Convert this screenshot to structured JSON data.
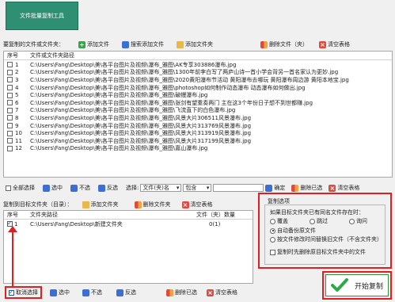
{
  "title_button": "文件批量复制工具",
  "top_toolbar": {
    "label": "要复制的文件或文件夹：",
    "add_file": "添加文件",
    "search_add_file": "搜索添加文件",
    "add_folder": "添加文件夹",
    "delete_file": "删除文件（夹）",
    "clear_table": "清空表格"
  },
  "file_table": {
    "columns": [
      "序号",
      "文件或文件夹路径"
    ],
    "rows": [
      {
        "num": "1",
        "path": "C:\\Users\\Fang\\Desktop\\美\\各平台图片及视频\\瀑布_雅图\\AK专享303886瀑布.jpg"
      },
      {
        "num": "2",
        "path": "C:\\Users\\Fang\\Desktop\\美\\各平台图片及视频\\瀑布_雅图\\1300年前李白写了两庐山诗一首小学会背另一首名家认为更妙.jpg"
      },
      {
        "num": "3",
        "path": "C:\\Users\\Fang\\Desktop\\美\\各平台图片及视频\\瀑布_雅图\\2020黄阳瀑布节活动 黄阳瀑布去哪玩 黄阳瀑布周边游 黄阳本地宝.jpg"
      },
      {
        "num": "4",
        "path": "C:\\Users\\Fang\\Desktop\\美\\各平台图片及视频\\瀑布_雅图\\photoshop如何制作动态瀑布 动态瀑布如何做出.jpg"
      },
      {
        "num": "5",
        "path": "C:\\Users\\Fang\\Desktop\\美\\各平台图片及视频\\瀑布_雅图\\破幔瀑布.jpg"
      },
      {
        "num": "6",
        "path": "C:\\Users\\Fang\\Desktop\\美\\各平台图片及视频\\瀑布_雅图\\张剑有望重奏两门 主在这3个年份日子想不到世都赚.jpg"
      },
      {
        "num": "7",
        "path": "C:\\Users\\Fang\\Desktop\\美\\各平台图片及视频\\瀑布_雅图\\飞流直下的白色瀑布.jpg"
      },
      {
        "num": "8",
        "path": "C:\\Users\\Fang\\Desktop\\美\\各平台图片及视频\\瀑布_雅图\\风景大片306511风景瀑布.jpg"
      },
      {
        "num": "9",
        "path": "C:\\Users\\Fang\\Desktop\\美\\各平台图片及视频\\瀑布_雅图\\风景大片313769风景瀑布.jpg"
      },
      {
        "num": "10",
        "path": "C:\\Users\\Fang\\Desktop\\美\\各平台图片及视频\\瀑布_雅图\\风景大片313919风景瀑布.jpg"
      },
      {
        "num": "11",
        "path": "C:\\Users\\Fang\\Desktop\\美\\各平台图片及视频\\瀑布_雅图\\风景大片317199风景瀑布.jpg"
      },
      {
        "num": "12",
        "path": "C:\\Users\\Fang\\Desktop\\美\\各平台图片及视频\\瀑布_雅图\\嘉山瀑布.jpg"
      }
    ]
  },
  "mid_toolbar": {
    "select_all": "全部选择",
    "select": "选中",
    "unselect": "不选",
    "invert": "反选",
    "choose_label": "选择:",
    "choose_value": "文件(夹)名",
    "contains_value": "包含",
    "confirm": "确定",
    "delete_selected": "删除已选",
    "clear_table": "清空表格"
  },
  "target_toolbar": {
    "label": "复制到目标文件夹（目录）：",
    "add_folder": "添加文件夹",
    "delete_folder": "删除文件夹",
    "clear_table": "清空表格"
  },
  "target_table": {
    "columns": [
      "序号",
      "文件夹路径",
      "文件（夹）数量"
    ],
    "rows": [
      {
        "num": "1",
        "path": "C:\\Users\\Fang\\Desktop\\新建文件夹",
        "count": "0(1)"
      }
    ]
  },
  "bottom_toolbar": {
    "cancel_select": "取消选择",
    "select": "选中",
    "unselect": "不选",
    "invert": "反选",
    "delete_selected": "删除已选",
    "clear_table": "清空表格"
  },
  "copy_options": {
    "title": "复制选项",
    "conflict_label": "如果目标文件夹已有同名文件存在时：",
    "overwrite": "覆盖",
    "skip": "跳过",
    "ask": "询问",
    "auto_rename": "自动备份原文件",
    "rename_by_time": "按文件修改时间替换旧文件（不含文件夹）",
    "clear_target": "复制时先删除原目标文件夹中的文件"
  },
  "start_button": "开始复制",
  "colors": {
    "title_bg": "#2f8f72",
    "highlight": "#e02020",
    "start_border": "#3c8a3c"
  }
}
